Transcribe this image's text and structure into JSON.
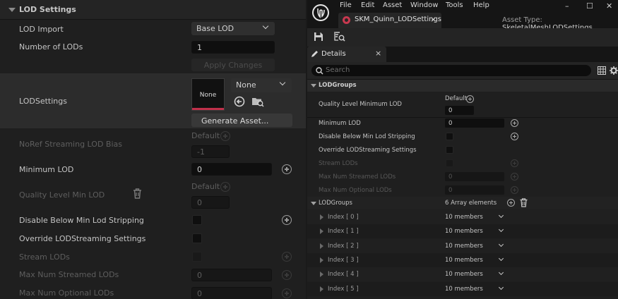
{
  "left_panel": {
    "section_title": "LOD Settings",
    "lod_import_label": "LOD Import",
    "lod_import_value": "Base LOD",
    "num_lods_label": "Number of LODs",
    "num_lods_value": "1",
    "apply_changes_label": "Apply Changes",
    "lodsettings_label": "LODSettings",
    "asset_thumb_text": "None",
    "asset_combo_value": "None",
    "generate_asset_label": "Generate Asset...",
    "noref_label": "NoRef Streaming LOD Bias",
    "noref_default": "Default",
    "noref_value": "-1",
    "min_lod_label": "Minimum LOD",
    "min_lod_value": "0",
    "quality_label": "Quality Level Min LOD",
    "quality_default": "Default",
    "quality_value": "0",
    "disable_below_label": "Disable Below Min Lod Stripping",
    "override_streaming_label": "Override LODStreaming Settings",
    "stream_lods_label": "Stream LODs",
    "max_streamed_label": "Max Num Streamed LODs",
    "max_streamed_value": "0",
    "max_optional_label": "Max Num Optional LODs",
    "max_optional_value": "0"
  },
  "window": {
    "menus": [
      "File",
      "Edit",
      "Asset",
      "Window",
      "Tools",
      "Help"
    ],
    "doc_tab_title": "SKM_Quinn_LODSettings",
    "asset_type_label": "Asset Type:",
    "asset_type_value": "SkeletalMeshLODSettings",
    "minimize": "–",
    "maximize": "☐",
    "close": "✕"
  },
  "details": {
    "tab_label": "Details",
    "tab_close": "×",
    "search_placeholder": "Search",
    "section_title": "LODGroups",
    "rows": {
      "quality_label": "Quality Level Minimum LOD",
      "quality_default": "Default",
      "quality_value": "0",
      "min_lod_label": "Minimum LOD",
      "min_lod_value": "0",
      "disable_below_label": "Disable Below Min Lod Stripping",
      "override_label": "Override LODStreaming Settings",
      "stream_lods_label": "Stream LODs",
      "max_streamed_label": "Max Num Streamed LODs",
      "max_streamed_value": "0",
      "max_optional_label": "Max Num Optional LODs",
      "max_optional_value": "0"
    },
    "lodgroups_array_label": "LODGroups",
    "lodgroups_count": "6 Array elements",
    "array_items": [
      {
        "index": "Index [ 0 ]",
        "members": "10 members"
      },
      {
        "index": "Index [ 1 ]",
        "members": "10 members"
      },
      {
        "index": "Index [ 2 ]",
        "members": "10 members"
      },
      {
        "index": "Index [ 3 ]",
        "members": "10 members"
      },
      {
        "index": "Index [ 4 ]",
        "members": "10 members"
      },
      {
        "index": "Index [ 5 ]",
        "members": "10 members"
      }
    ]
  },
  "colors": {
    "accent_red": "#c8384f",
    "panel_bg": "#1f1f1f",
    "highlight_row": "#2c2c2c"
  }
}
